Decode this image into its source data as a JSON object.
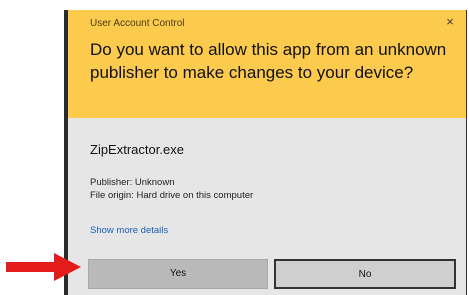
{
  "dialog": {
    "title": "User Account Control",
    "close_glyph": "×",
    "question": "Do you want to allow this app from an unknown publisher to make changes to your device?",
    "app_name": "ZipExtractor.exe",
    "publisher_line": "Publisher: Unknown",
    "origin_line": "File origin: Hard drive on this computer",
    "more_details_link": "Show more details",
    "yes_label": "Yes",
    "no_label": "No"
  },
  "annotation": {
    "arrow_icon": "red-arrow-pointing-right",
    "color": "#e31b1b"
  },
  "colors": {
    "header_bg": "#fccb4e",
    "body_bg": "#e6e6e6",
    "link": "#1a5fb4"
  }
}
